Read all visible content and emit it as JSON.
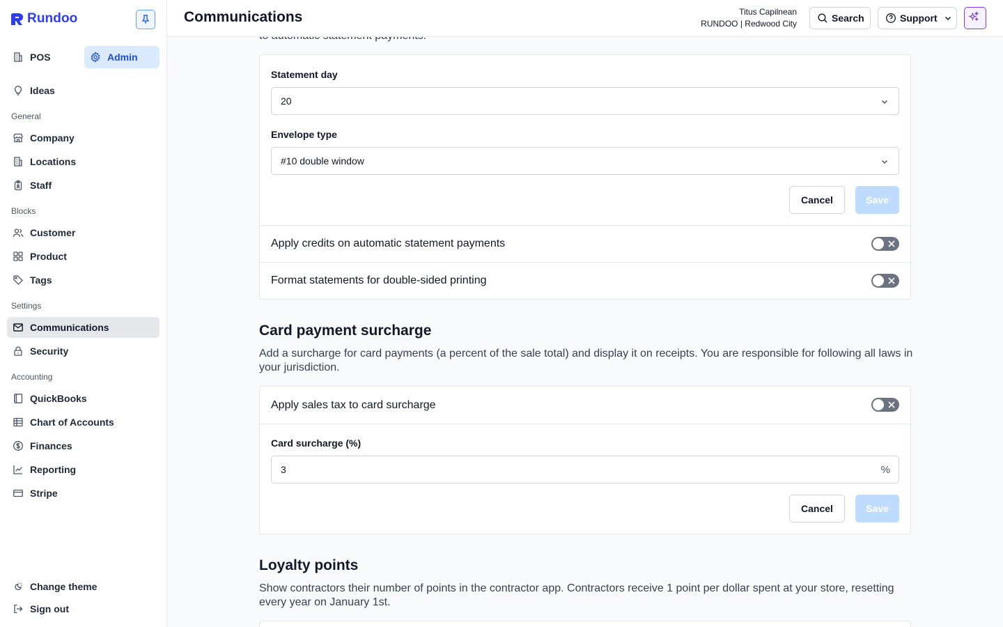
{
  "brand": {
    "name": "Rundoo"
  },
  "sidebar": {
    "modes": [
      {
        "label": "POS",
        "icon": "building-icon"
      },
      {
        "label": "Admin",
        "icon": "gear-icon"
      }
    ],
    "ideas": {
      "label": "Ideas",
      "icon": "lightbulb-icon"
    },
    "sections": {
      "general": "General",
      "blocks": "Blocks",
      "settings": "Settings",
      "accounting": "Accounting"
    },
    "general_items": [
      {
        "label": "Company",
        "icon": "store-icon"
      },
      {
        "label": "Locations",
        "icon": "building-icon"
      },
      {
        "label": "Staff",
        "icon": "badge-icon"
      }
    ],
    "blocks_items": [
      {
        "label": "Customer",
        "icon": "users-icon"
      },
      {
        "label": "Product",
        "icon": "grid-icon"
      },
      {
        "label": "Tags",
        "icon": "tag-icon"
      }
    ],
    "settings_items": [
      {
        "label": "Communications",
        "icon": "mail-icon"
      },
      {
        "label": "Security",
        "icon": "lock-icon"
      }
    ],
    "accounting_items": [
      {
        "label": "QuickBooks",
        "icon": "book-icon"
      },
      {
        "label": "Chart of Accounts",
        "icon": "table-icon"
      },
      {
        "label": "Finances",
        "icon": "dollar-icon"
      },
      {
        "label": "Reporting",
        "icon": "chart-line-icon"
      },
      {
        "label": "Stripe",
        "icon": "credit-card-icon"
      }
    ],
    "footer": {
      "theme": "Change theme",
      "signout": "Sign out"
    }
  },
  "header": {
    "title": "Communications",
    "user_name": "Titus Capilnean",
    "user_org": "RUNDOO | Redwood City",
    "search_label": "Search",
    "support_label": "Support"
  },
  "main": {
    "cutoff_text": "to automatic statement payments.",
    "statements": {
      "statement_day_label": "Statement day",
      "statement_day_value": "20",
      "envelope_label": "Envelope type",
      "envelope_value": "#10 double window",
      "cancel": "Cancel",
      "save": "Save",
      "toggles": [
        {
          "label": "Apply credits on automatic statement payments",
          "on": false
        },
        {
          "label": "Format statements for double-sided printing",
          "on": false
        }
      ]
    },
    "surcharge": {
      "title": "Card payment surcharge",
      "description": "Add a surcharge for card payments (a percent of the sale total) and display it on receipts. You are responsible for following all laws in your jurisdiction.",
      "tax_toggle_label": "Apply sales tax to card surcharge",
      "tax_toggle_on": false,
      "field_label": "Card surcharge (%)",
      "field_value": "3",
      "field_suffix": "%",
      "cancel": "Cancel",
      "save": "Save"
    },
    "loyalty": {
      "title": "Loyalty points",
      "description": "Show contractors their number of points in the contractor app. Contractors receive 1 point per dollar spent at your store, resetting every year on January 1st."
    }
  },
  "colors": {
    "brand": "#2f3df0",
    "admin_bg": "#dbeafe",
    "admin_text": "#1d4ed8",
    "active_nav_bg": "#e5e7eb",
    "save_disabled": "#bfdbfe",
    "toggle_off": "#6b7280",
    "ai_accent": "#7c3aed"
  }
}
